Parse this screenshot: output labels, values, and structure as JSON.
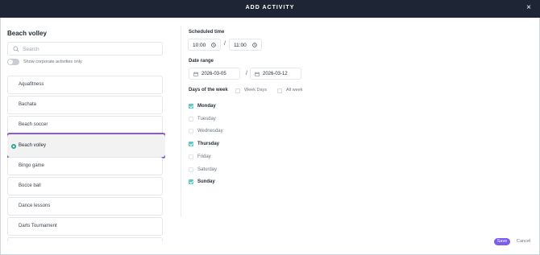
{
  "header": {
    "title": "ADD ACTIVITY",
    "close_label": "×"
  },
  "left": {
    "activity_title": "Beach volley",
    "search": {
      "placeholder": "Search",
      "value": ""
    },
    "corporate_toggle": {
      "label": "Show corporate activities only",
      "on": false
    },
    "activities": [
      {
        "label": "Aquafitness",
        "selected": false
      },
      {
        "label": "Bachata",
        "selected": false
      },
      {
        "label": "Beach soccer",
        "selected": false
      },
      {
        "label": "Beach volley",
        "selected": true
      },
      {
        "label": "Bingo game",
        "selected": false
      },
      {
        "label": "Bocce ball",
        "selected": false
      },
      {
        "label": "Dance lessons",
        "selected": false
      },
      {
        "label": "Darts Tournament",
        "selected": false
      }
    ]
  },
  "schedule": {
    "time_label": "Scheduled time",
    "start_time": "10:00",
    "separator": "/",
    "end_time": "11:00",
    "range_label": "Date range",
    "start_date": "2026-03-05",
    "end_date": "2026-03-12",
    "days_label": "Days of the week",
    "week_days_label": "Week Days",
    "all_week_label": "All week",
    "days": [
      {
        "label": "Monday",
        "checked": true
      },
      {
        "label": "Tuesday",
        "checked": false
      },
      {
        "label": "Wednesday",
        "checked": false
      },
      {
        "label": "Thursday",
        "checked": true
      },
      {
        "label": "Friday",
        "checked": false
      },
      {
        "label": "Saturday",
        "checked": false
      },
      {
        "label": "Sunday",
        "checked": true
      }
    ]
  },
  "footer": {
    "save_label": "Save",
    "cancel_label": "Cancel"
  },
  "colors": {
    "accent": "#7b5cf0",
    "selected_border": "#8a5bd6",
    "check": "#5ec9c0",
    "header_bg": "#1e2535"
  }
}
